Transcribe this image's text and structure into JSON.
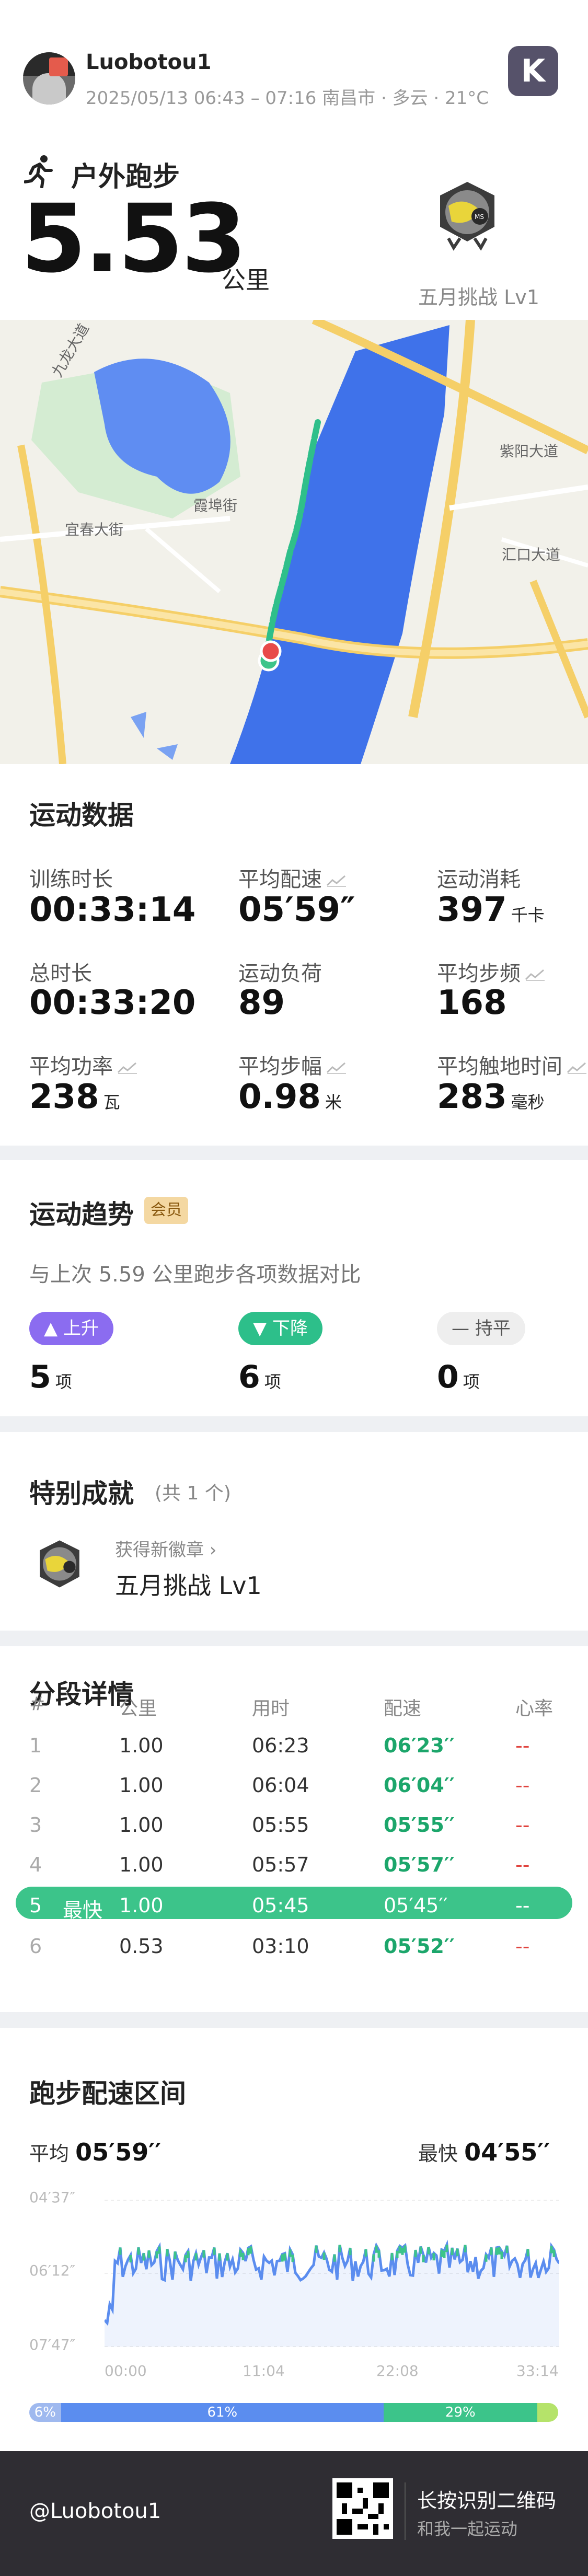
{
  "header": {
    "username": "Luobotou1",
    "meta": "2025/05/13 06:43 – 07:16 南昌市 · 多云 · 21°C",
    "activity_type": "户外跑步",
    "distance_value": "5.53",
    "distance_unit": "公里",
    "badge_label": "五月挑战 Lv1",
    "app_logo": "K"
  },
  "map": {
    "labels": {
      "jiuhua": "九龙大道",
      "yichun": "宜春大街",
      "xiabu": "霞埠街",
      "ziyang": "紫阳大道",
      "huikou": "汇口大道"
    }
  },
  "stats": {
    "title": "运动数据",
    "items": [
      {
        "label": "训练时长",
        "value": "00:33:14",
        "unit": "",
        "trend": false
      },
      {
        "label": "平均配速",
        "value": "05′59″",
        "unit": "",
        "trend": true
      },
      {
        "label": "运动消耗",
        "value": "397",
        "unit": "千卡",
        "trend": false
      },
      {
        "label": "总时长",
        "value": "00:33:20",
        "unit": "",
        "trend": false
      },
      {
        "label": "运动负荷",
        "value": "89",
        "unit": "",
        "trend": false
      },
      {
        "label": "平均步频",
        "value": "168",
        "unit": "",
        "trend": true
      },
      {
        "label": "平均功率",
        "value": "238",
        "unit": "瓦",
        "trend": true
      },
      {
        "label": "平均步幅",
        "value": "0.98",
        "unit": "米",
        "trend": true
      },
      {
        "label": "平均触地时间",
        "value": "283",
        "unit": "毫秒",
        "trend": true
      }
    ]
  },
  "trend": {
    "title": "运动趋势",
    "member_tag": "会员",
    "subtitle": "与上次 5.59 公里跑步各项数据对比",
    "up": {
      "label": "上升",
      "count": "5",
      "unit": "项"
    },
    "down": {
      "label": "下降",
      "count": "6",
      "unit": "项"
    },
    "flat": {
      "label": "持平",
      "count": "0",
      "unit": "项"
    }
  },
  "achievement": {
    "title": "特别成就",
    "count_text": "(共 1 个)",
    "tag": "获得新徽章",
    "name": "五月挑战 Lv1"
  },
  "splits": {
    "title": "分段详情",
    "headers": [
      "#",
      "公里",
      "用时",
      "配速",
      "心率"
    ],
    "fastest_label": "最快",
    "rows": [
      {
        "idx": "1",
        "km": "1.00",
        "time": "06:23",
        "pace": "06′23′′",
        "hr": "--"
      },
      {
        "idx": "2",
        "km": "1.00",
        "time": "06:04",
        "pace": "06′04′′",
        "hr": "--"
      },
      {
        "idx": "3",
        "km": "1.00",
        "time": "05:55",
        "pace": "05′55′′",
        "hr": "--"
      },
      {
        "idx": "4",
        "km": "1.00",
        "time": "05:57",
        "pace": "05′57′′",
        "hr": "--"
      },
      {
        "idx": "5",
        "km": "1.00",
        "time": "05:45",
        "pace": "05′45′′",
        "hr": "--"
      },
      {
        "idx": "6",
        "km": "0.53",
        "time": "03:10",
        "pace": "05′52′′",
        "hr": "--"
      }
    ]
  },
  "pace_zone": {
    "title": "跑步配速区间",
    "avg_label": "平均",
    "avg_value": "05′59′′",
    "fastest_label": "最快",
    "fastest_value": "04′55′′",
    "y_ticks": [
      "04′37″",
      "06′12″",
      "07′47″"
    ],
    "x_ticks": [
      "00:00",
      "11:04",
      "22:08",
      "33:14"
    ],
    "zones": [
      {
        "label": "6%",
        "percent": 6,
        "color": "#9fb9ef"
      },
      {
        "label": "61%",
        "percent": 61,
        "color": "#5b8def"
      },
      {
        "label": "29%",
        "percent": 29,
        "color": "#3cc48a"
      },
      {
        "label": "",
        "percent": 4,
        "color": "#b5e36a"
      }
    ]
  },
  "footer": {
    "handle": "@Luobotou1",
    "scan_title": "长按识别二维码",
    "scan_sub": "和我一起运动"
  }
}
